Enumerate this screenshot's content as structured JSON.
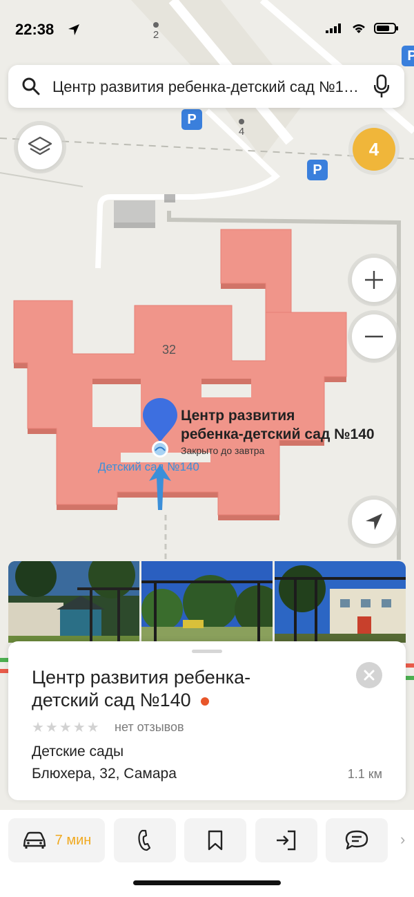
{
  "status_bar": {
    "time": "22:38",
    "icons": [
      "location-arrow-icon",
      "signal-icon",
      "wifi-icon",
      "battery-icon"
    ]
  },
  "search": {
    "value": "Центр развития ребенка-детский сад №140",
    "icons": [
      "search-icon",
      "microphone-icon"
    ]
  },
  "map": {
    "traffic_level": "4",
    "building_number": "32",
    "house_label_1": "2",
    "house_label_2": "4",
    "poi_title_line1": "Центр развития",
    "poi_title_line2": "ребенка-детский сад №140",
    "poi_status": "Закрыто до завтра",
    "kindergarten_label": "Детский сад №140",
    "parking_label": "P",
    "colors": {
      "building": "#f0958a",
      "road": "#ffffff",
      "traffic": "#f0b63a",
      "pin": "#3d6fe0",
      "entrance_arrow": "#3b8fd9"
    }
  },
  "card": {
    "title_line1": "Центр развития ребенка-",
    "title_line2": "детский сад №140",
    "stars": "★★★★★",
    "reviews": "нет отзывов",
    "category": "Детские сады",
    "address": "Блюхера, 32, Самара",
    "distance": "1.1 км",
    "colors": {
      "closed_dot": "#e8562a",
      "stars_empty": "#d2d2d2"
    }
  },
  "actions": {
    "route_time": "7 мин",
    "icons": [
      "car-icon",
      "phone-icon",
      "bookmark-icon",
      "entrance-icon",
      "chat-icon"
    ]
  }
}
